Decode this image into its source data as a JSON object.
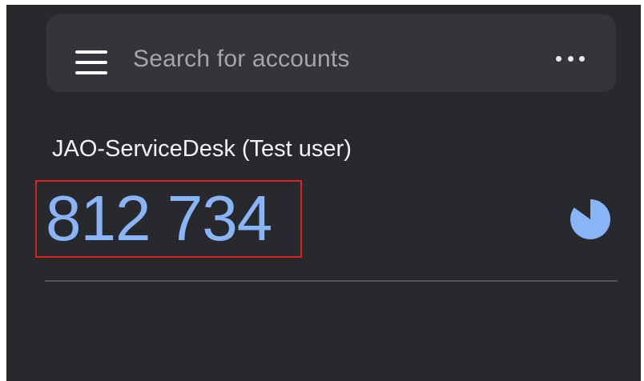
{
  "search": {
    "placeholder": "Search for accounts"
  },
  "icons": {
    "menu": "hamburger-menu-icon",
    "more": "more-horizontal-icon",
    "timer": "countdown-timer-icon"
  },
  "account": {
    "name": "JAO-ServiceDesk (Test user)",
    "code": "812 734",
    "timer_remaining_fraction": 0.85
  },
  "colors": {
    "background": "#28292c",
    "search_bar": "#34353a",
    "code": "#8ab4f8",
    "highlight_box": "#e02020"
  }
}
